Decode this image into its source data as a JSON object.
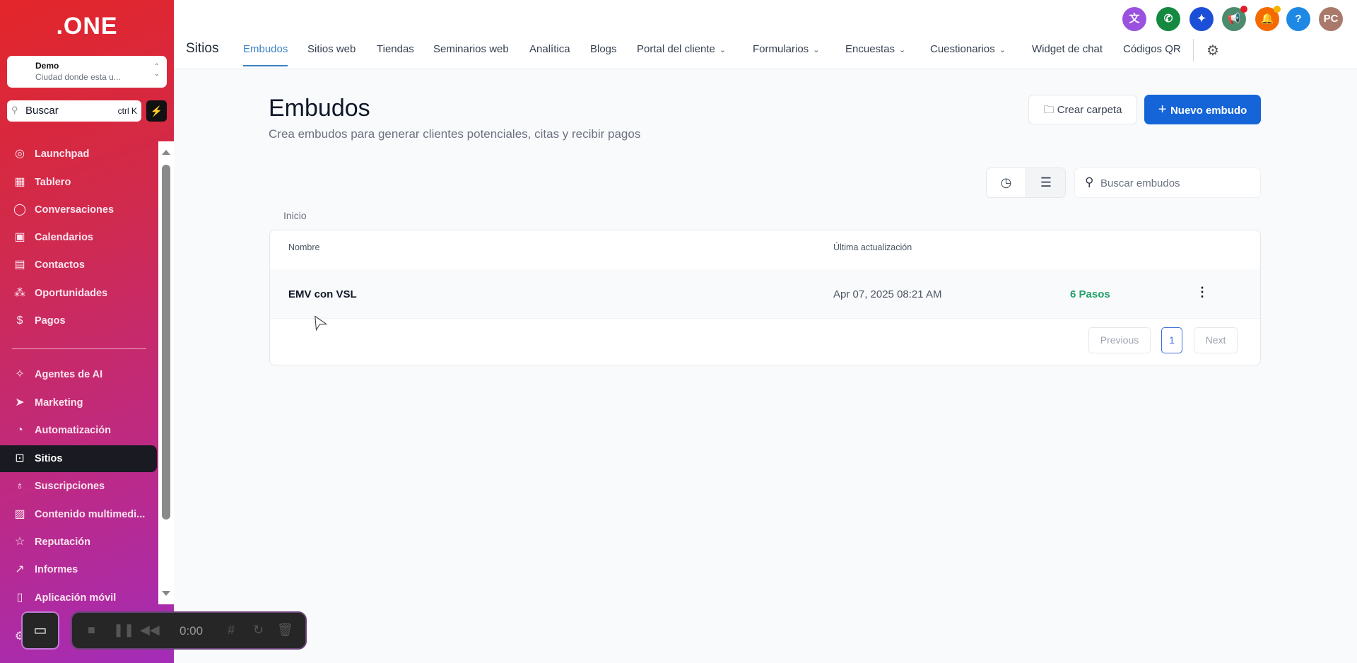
{
  "sidebar": {
    "logo": ".ONE",
    "location": {
      "name": "Demo",
      "subtitle": "Ciudad donde esta u..."
    },
    "search": {
      "label": "Buscar",
      "shortcut": "ctrl K"
    },
    "items": [
      {
        "label": "Launchpad",
        "icon": "rocket-icon"
      },
      {
        "label": "Tablero",
        "icon": "grid-icon"
      },
      {
        "label": "Conversaciones",
        "icon": "chat-icon"
      },
      {
        "label": "Calendarios",
        "icon": "calendar-icon"
      },
      {
        "label": "Contactos",
        "icon": "contacts-icon"
      },
      {
        "label": "Oportunidades",
        "icon": "pipeline-icon"
      },
      {
        "label": "Pagos",
        "icon": "invoice-icon"
      }
    ],
    "items2": [
      {
        "label": "Agentes de AI",
        "icon": "sparkles-icon"
      },
      {
        "label": "Marketing",
        "icon": "send-icon"
      },
      {
        "label": "Automatización",
        "icon": "automation-icon"
      },
      {
        "label": "Sitios",
        "icon": "globe-window-icon",
        "active": true
      },
      {
        "label": "Suscripciones",
        "icon": "badge-icon"
      },
      {
        "label": "Contenido multimedi...",
        "icon": "image-icon"
      },
      {
        "label": "Reputación",
        "icon": "star-icon"
      },
      {
        "label": "Informes",
        "icon": "trend-icon"
      },
      {
        "label": "Aplicación móvil",
        "icon": "phone-icon"
      }
    ]
  },
  "recorder": {
    "time": "0:00"
  },
  "header": {
    "section": "Sitios",
    "avatar": "PC",
    "help": "?",
    "icon_colors": [
      "#9b51e0",
      "#14893f",
      "#1b4fd8",
      "#4b8b6e",
      "#f56a00",
      "#1e88e5",
      "#a9796b"
    ],
    "tabs": [
      {
        "label": "Embudos",
        "active": true
      },
      {
        "label": "Sitios web"
      },
      {
        "label": "Tiendas"
      },
      {
        "label": "Seminarios web"
      },
      {
        "label": "Analítica"
      },
      {
        "label": "Blogs"
      },
      {
        "label": "Portal del cliente",
        "dropdown": true
      },
      {
        "label": "Formularios",
        "dropdown": true
      },
      {
        "label": "Encuestas",
        "dropdown": true
      },
      {
        "label": "Cuestionarios",
        "dropdown": true
      },
      {
        "label": "Widget de chat"
      },
      {
        "label": "Códigos QR"
      }
    ]
  },
  "page": {
    "title": "Embudos",
    "subtitle": "Crea embudos para generar clientes potenciales, citas y recibir pagos",
    "create_folder": "Crear carpeta",
    "new_funnel": "Nuevo embudo",
    "search_placeholder": "Buscar embudos",
    "breadcrumb": "Inicio"
  },
  "table": {
    "columns": [
      "Nombre",
      "Última actualización"
    ],
    "rows": [
      {
        "name": "EMV con VSL",
        "updated": "Apr 07, 2025 08:21 AM",
        "steps": "6 Pasos"
      }
    ],
    "pagination": {
      "previous": "Previous",
      "current": "1",
      "next": "Next"
    }
  }
}
